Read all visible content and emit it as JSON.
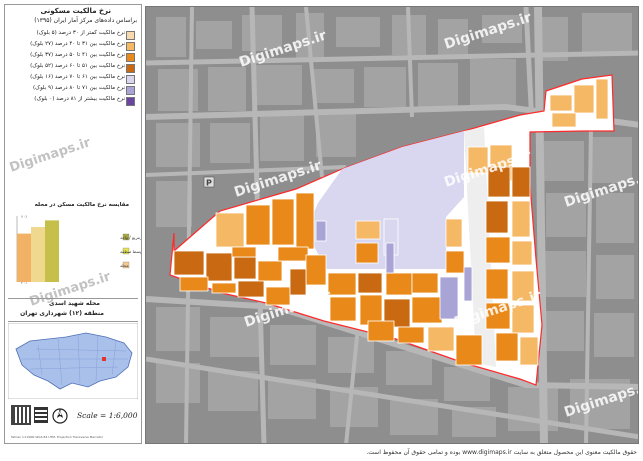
{
  "legend": {
    "title": "نرخ مالکیت مسکونی",
    "subtitle": "براساس داده‌های مرکز آمار ایران (۱۳۹۵)",
    "items": [
      {
        "label": "نرخ مالکیت کمتر از ۳۰ درصد (۵ بلوک)",
        "color": "#f7d9b0"
      },
      {
        "label": "نرخ مالکیت بین ۳۱ تا ۴۰ درصد (۲۷ بلوک)",
        "color": "#f5b865"
      },
      {
        "label": "نرخ مالکیت بین ۴۱ تا ۵۰ درصد (۳۷ بلوک)",
        "color": "#e8891a"
      },
      {
        "label": "نرخ مالکیت بین ۵۱ تا ۶۰ درصد (۵۲ بلوک)",
        "color": "#c96a12"
      },
      {
        "label": "نرخ مالکیت بین ۶۱ تا ۷۰ درصد (۱۶ بلوک)",
        "color": "#d8d7ef"
      },
      {
        "label": "نرخ مالکیت بین ۷۱ تا ۸۰ درصد (۹ بلوک)",
        "color": "#a9a4d6"
      },
      {
        "label": "نرخ مالکیت بیشتر از ۸۱ درصد (۰ بلوک)",
        "color": "#6a46a0"
      }
    ]
  },
  "comparison": {
    "title": "مقایسه نرخ مالکیت مسکن در محله",
    "ticks": [
      "۶۰٪",
      "۵۰٪",
      "۴۰٪",
      "۳۰٪"
    ],
    "bars": [
      {
        "name": "میانگین محله",
        "value": 52,
        "color": "#f1b266"
      },
      {
        "name": "میانگین منطقه",
        "value": 55,
        "color": "#f0d98e"
      },
      {
        "name": "میانگین شهر",
        "value": 58,
        "color": "#c6c04a"
      }
    ],
    "legend": [
      {
        "label": "متوسط مترمربع / واحد",
        "color": "#a7a840"
      },
      {
        "label": "متوسط منطقه",
        "color": "#e3e354"
      },
      {
        "label": "محله",
        "color": "#f3c98f"
      }
    ]
  },
  "district": {
    "name": "محله شهید اسدی",
    "region": "منطقه (۱۲) شهرداری تهران"
  },
  "scale": "Scale = 1:6,000",
  "north": "N",
  "credit_small": "Tehran 1:12000 WGS 84 UTM, Projection Transverse Mercator",
  "footer": "حقوق مالکیت معنوی این محصول متعلق به سایت www.digimaps.ir بوده و تمامی حقوق آن محفوظ است.",
  "watermark": "Digimaps.ir",
  "colors": {
    "road": "#b4b4b4",
    "background": "#8e8e8e",
    "boundary": "#ff2a2a"
  }
}
